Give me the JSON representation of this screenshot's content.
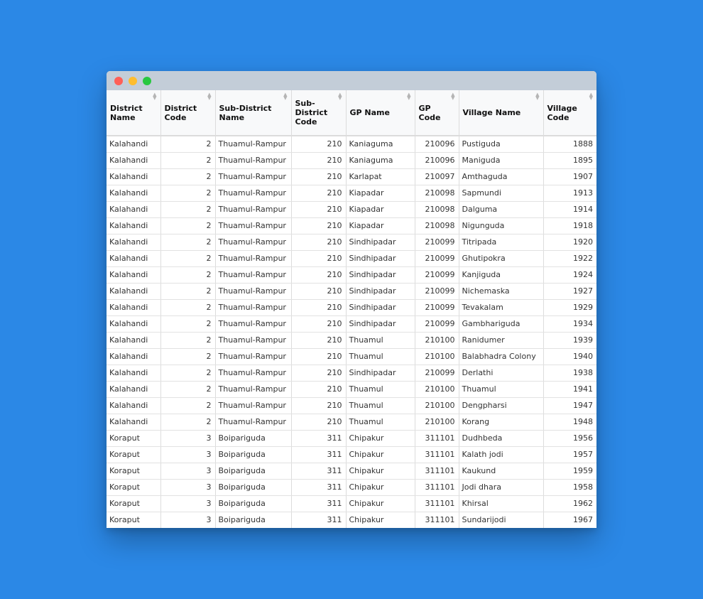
{
  "window": {
    "controls": [
      "close",
      "minimize",
      "maximize"
    ]
  },
  "table": {
    "columns": [
      {
        "label": "District Name",
        "align": "left"
      },
      {
        "label": "District Code",
        "align": "right"
      },
      {
        "label": "Sub-District Name",
        "align": "left"
      },
      {
        "label": "Sub-District Code",
        "align": "right"
      },
      {
        "label": "GP Name",
        "align": "left"
      },
      {
        "label": "GP Code",
        "align": "right"
      },
      {
        "label": "Village Name",
        "align": "left"
      },
      {
        "label": "Village Code",
        "align": "right"
      }
    ],
    "rows": [
      [
        "Kalahandi",
        "2",
        "Thuamul-Rampur",
        "210",
        "Kaniaguma",
        "210096",
        "Pustiguda",
        "1888"
      ],
      [
        "Kalahandi",
        "2",
        "Thuamul-Rampur",
        "210",
        "Kaniaguma",
        "210096",
        "Maniguda",
        "1895"
      ],
      [
        "Kalahandi",
        "2",
        "Thuamul-Rampur",
        "210",
        "Karlapat",
        "210097",
        "Amthaguda",
        "1907"
      ],
      [
        "Kalahandi",
        "2",
        "Thuamul-Rampur",
        "210",
        "Kiapadar",
        "210098",
        "Sapmundi",
        "1913"
      ],
      [
        "Kalahandi",
        "2",
        "Thuamul-Rampur",
        "210",
        "Kiapadar",
        "210098",
        "Dalguma",
        "1914"
      ],
      [
        "Kalahandi",
        "2",
        "Thuamul-Rampur",
        "210",
        "Kiapadar",
        "210098",
        "Nigunguda",
        "1918"
      ],
      [
        "Kalahandi",
        "2",
        "Thuamul-Rampur",
        "210",
        "Sindhipadar",
        "210099",
        "Titripada",
        "1920"
      ],
      [
        "Kalahandi",
        "2",
        "Thuamul-Rampur",
        "210",
        "Sindhipadar",
        "210099",
        "Ghutipokra",
        "1922"
      ],
      [
        "Kalahandi",
        "2",
        "Thuamul-Rampur",
        "210",
        "Sindhipadar",
        "210099",
        "Kanjiguda",
        "1924"
      ],
      [
        "Kalahandi",
        "2",
        "Thuamul-Rampur",
        "210",
        "Sindhipadar",
        "210099",
        "Nichemaska",
        "1927"
      ],
      [
        "Kalahandi",
        "2",
        "Thuamul-Rampur",
        "210",
        "Sindhipadar",
        "210099",
        "Tevakalam",
        "1929"
      ],
      [
        "Kalahandi",
        "2",
        "Thuamul-Rampur",
        "210",
        "Sindhipadar",
        "210099",
        "Gambhariguda",
        "1934"
      ],
      [
        "Kalahandi",
        "2",
        "Thuamul-Rampur",
        "210",
        "Thuamul",
        "210100",
        "Ranidumer",
        "1939"
      ],
      [
        "Kalahandi",
        "2",
        "Thuamul-Rampur",
        "210",
        "Thuamul",
        "210100",
        "Balabhadra Colony",
        "1940"
      ],
      [
        "Kalahandi",
        "2",
        "Thuamul-Rampur",
        "210",
        "Sindhipadar",
        "210099",
        "Derlathi",
        "1938"
      ],
      [
        "Kalahandi",
        "2",
        "Thuamul-Rampur",
        "210",
        "Thuamul",
        "210100",
        "Thuamul",
        "1941"
      ],
      [
        "Kalahandi",
        "2",
        "Thuamul-Rampur",
        "210",
        "Thuamul",
        "210100",
        "Dengpharsi",
        "1947"
      ],
      [
        "Kalahandi",
        "2",
        "Thuamul-Rampur",
        "210",
        "Thuamul",
        "210100",
        "Korang",
        "1948"
      ],
      [
        "Koraput",
        "3",
        "Boipariguda",
        "311",
        "Chipakur",
        "311101",
        "Dudhbeda",
        "1956"
      ],
      [
        "Koraput",
        "3",
        "Boipariguda",
        "311",
        "Chipakur",
        "311101",
        "Kalath jodi",
        "1957"
      ],
      [
        "Koraput",
        "3",
        "Boipariguda",
        "311",
        "Chipakur",
        "311101",
        "Kaukund",
        "1959"
      ],
      [
        "Koraput",
        "3",
        "Boipariguda",
        "311",
        "Chipakur",
        "311101",
        "Jodi dhara",
        "1958"
      ],
      [
        "Koraput",
        "3",
        "Boipariguda",
        "311",
        "Chipakur",
        "311101",
        "Khirsal",
        "1962"
      ],
      [
        "Koraput",
        "3",
        "Boipariguda",
        "311",
        "Chipakur",
        "311101",
        "Sundarijodi",
        "1967"
      ]
    ]
  }
}
